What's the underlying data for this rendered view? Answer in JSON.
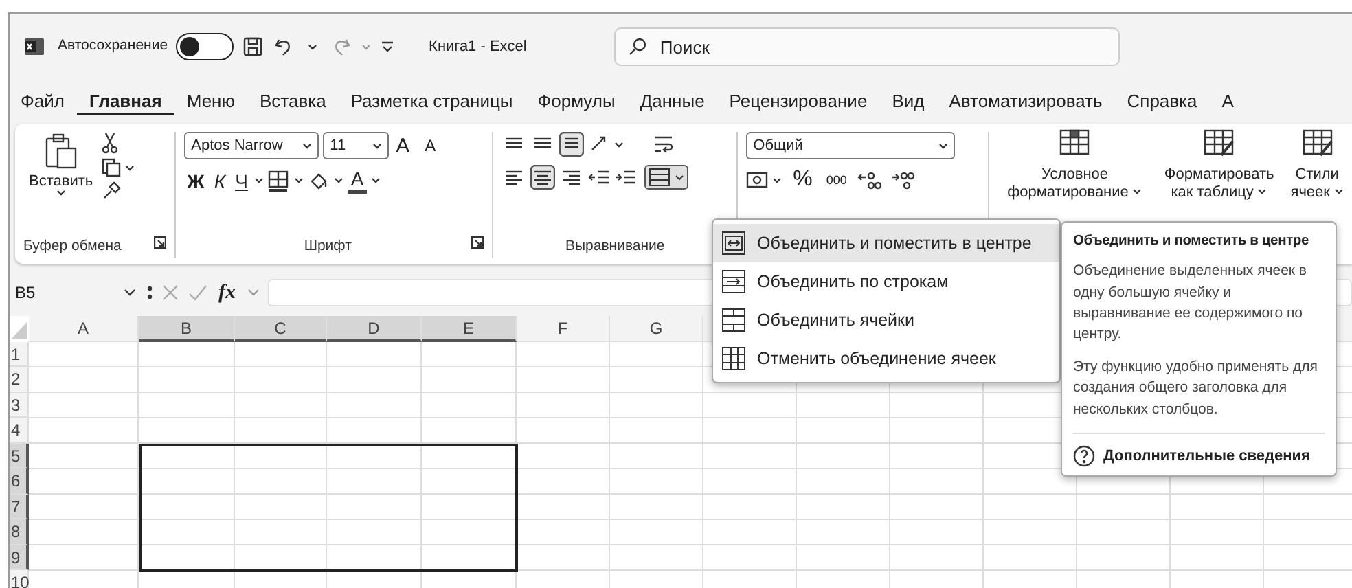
{
  "title_bar": {
    "autosave_label": "Автосохранение",
    "autosave_on": false,
    "title": "Книга1 - Excel",
    "search_placeholder": "Поиск"
  },
  "tabs": [
    {
      "label": "Файл",
      "selected": false
    },
    {
      "label": "Главная",
      "selected": true
    },
    {
      "label": "Меню",
      "selected": false
    },
    {
      "label": "Вставка",
      "selected": false
    },
    {
      "label": "Разметка страницы",
      "selected": false
    },
    {
      "label": "Формулы",
      "selected": false
    },
    {
      "label": "Данные",
      "selected": false
    },
    {
      "label": "Рецензирование",
      "selected": false
    },
    {
      "label": "Вид",
      "selected": false
    },
    {
      "label": "Автоматизировать",
      "selected": false
    },
    {
      "label": "Справка",
      "selected": false
    },
    {
      "label": "А",
      "selected": false
    }
  ],
  "ribbon": {
    "clipboard": {
      "paste": "Вставить",
      "label": "Буфер обмена"
    },
    "font": {
      "name": "Aptos Narrow",
      "size": "11",
      "grow": "A",
      "shrink": "A",
      "bold": "Ж",
      "italic": "К",
      "underline": "Ч",
      "font_color_label": "A",
      "label": "Шрифт"
    },
    "alignment": {
      "label": "Выравнивание",
      "merge_open": true
    },
    "number": {
      "format": "Общий",
      "percent": "%",
      "thousands": "000"
    },
    "styles": [
      {
        "line1": "Условное",
        "line2": "форматирование"
      },
      {
        "line1": "Форматировать",
        "line2": "как таблицу"
      },
      {
        "line1": "Стили",
        "line2": "ячеек"
      }
    ]
  },
  "formula_bar": {
    "name_box": "B5",
    "fx": "fx"
  },
  "sheet": {
    "columns": [
      {
        "label": "A",
        "selected": false
      },
      {
        "label": "B",
        "selected": true
      },
      {
        "label": "C",
        "selected": true
      },
      {
        "label": "D",
        "selected": true
      },
      {
        "label": "E",
        "selected": true
      },
      {
        "label": "F",
        "selected": false
      },
      {
        "label": "G",
        "selected": false
      }
    ],
    "rows": [
      {
        "label": "1",
        "selected": false
      },
      {
        "label": "2",
        "selected": false
      },
      {
        "label": "3",
        "selected": false
      },
      {
        "label": "4",
        "selected": false
      },
      {
        "label": "5",
        "selected": true
      },
      {
        "label": "6",
        "selected": true
      },
      {
        "label": "7",
        "selected": true
      },
      {
        "label": "8",
        "selected": true
      },
      {
        "label": "9",
        "selected": true
      },
      {
        "label": "10",
        "selected": false
      }
    ]
  },
  "merge_menu": {
    "items": [
      {
        "label": "Объединить и поместить в центре",
        "selected": true
      },
      {
        "label": "Объединить по строкам",
        "selected": false
      },
      {
        "label": "Объединить ячейки",
        "selected": false
      },
      {
        "label": "Отменить объединение ячеек",
        "selected": false
      }
    ]
  },
  "tooltip": {
    "title": "Объединить и поместить в центре",
    "paragraphs": [
      "Объединение выделенных ячеек в одну большую ячейку и выравнивание ее содержимого по центру.",
      "Эту функцию удобно применять для создания общего заголовка для нескольких столбцов."
    ],
    "link": "Дополнительные сведения"
  }
}
